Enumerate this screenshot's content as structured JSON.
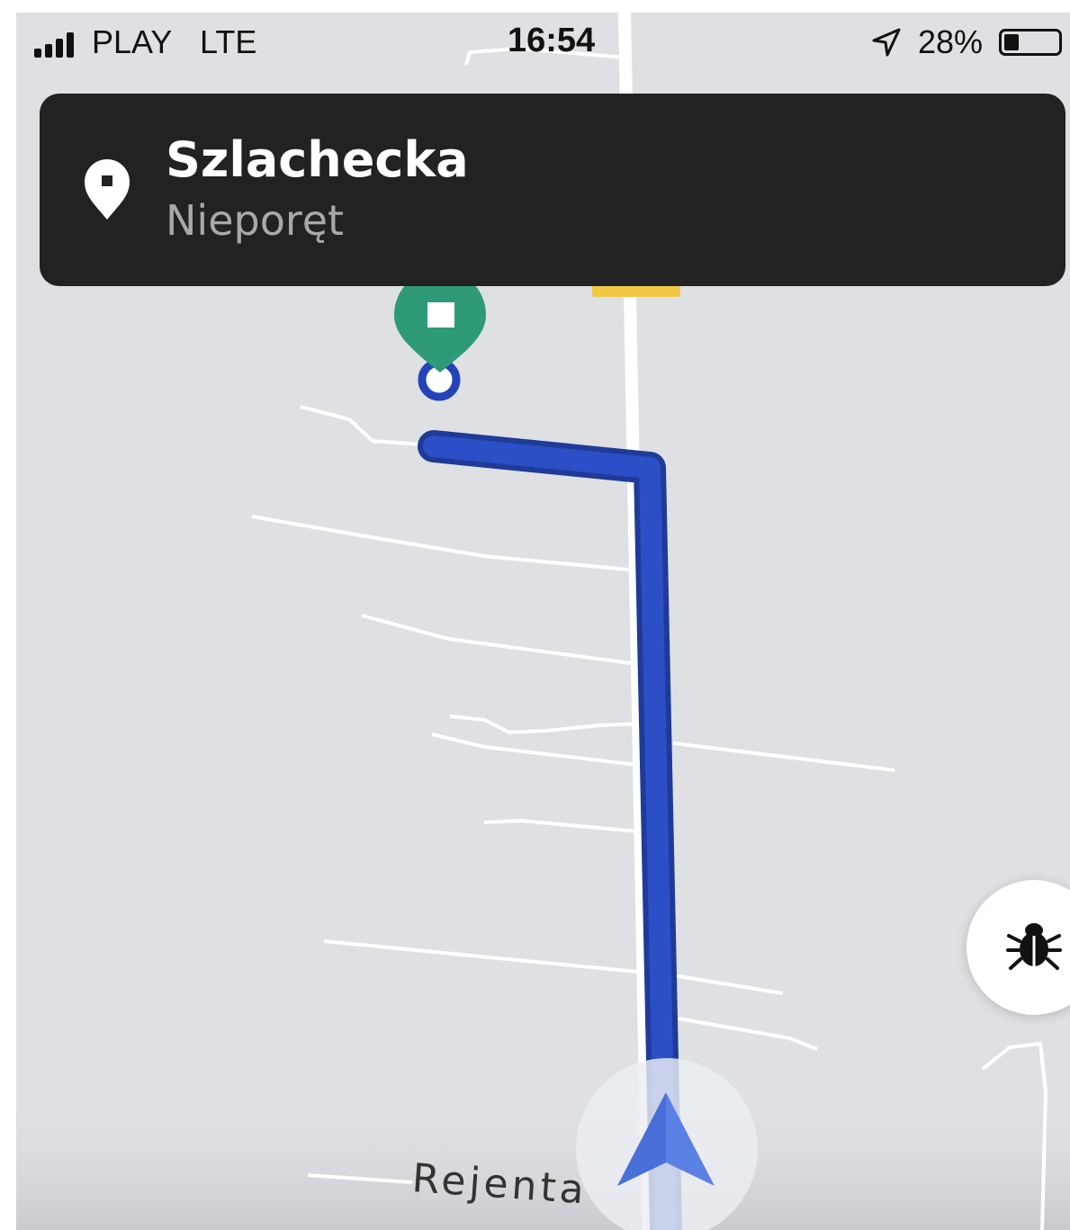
{
  "status_bar": {
    "carrier": "PLAY",
    "network": "LTE",
    "time": "16:54",
    "battery_percent": "28%",
    "battery_level": 0.28,
    "signal_bars": 4
  },
  "banner": {
    "street": "Szlachecka",
    "city": "Nieporęt",
    "icon": "location-pin-icon"
  },
  "map": {
    "road_label": "Rejenta",
    "route_color": "#2c4fc7",
    "destination_marker_color": "#2e9a77",
    "buttons": {
      "debug_icon": "bug-icon",
      "recenter_icon": "navigation-arrow-icon"
    }
  }
}
